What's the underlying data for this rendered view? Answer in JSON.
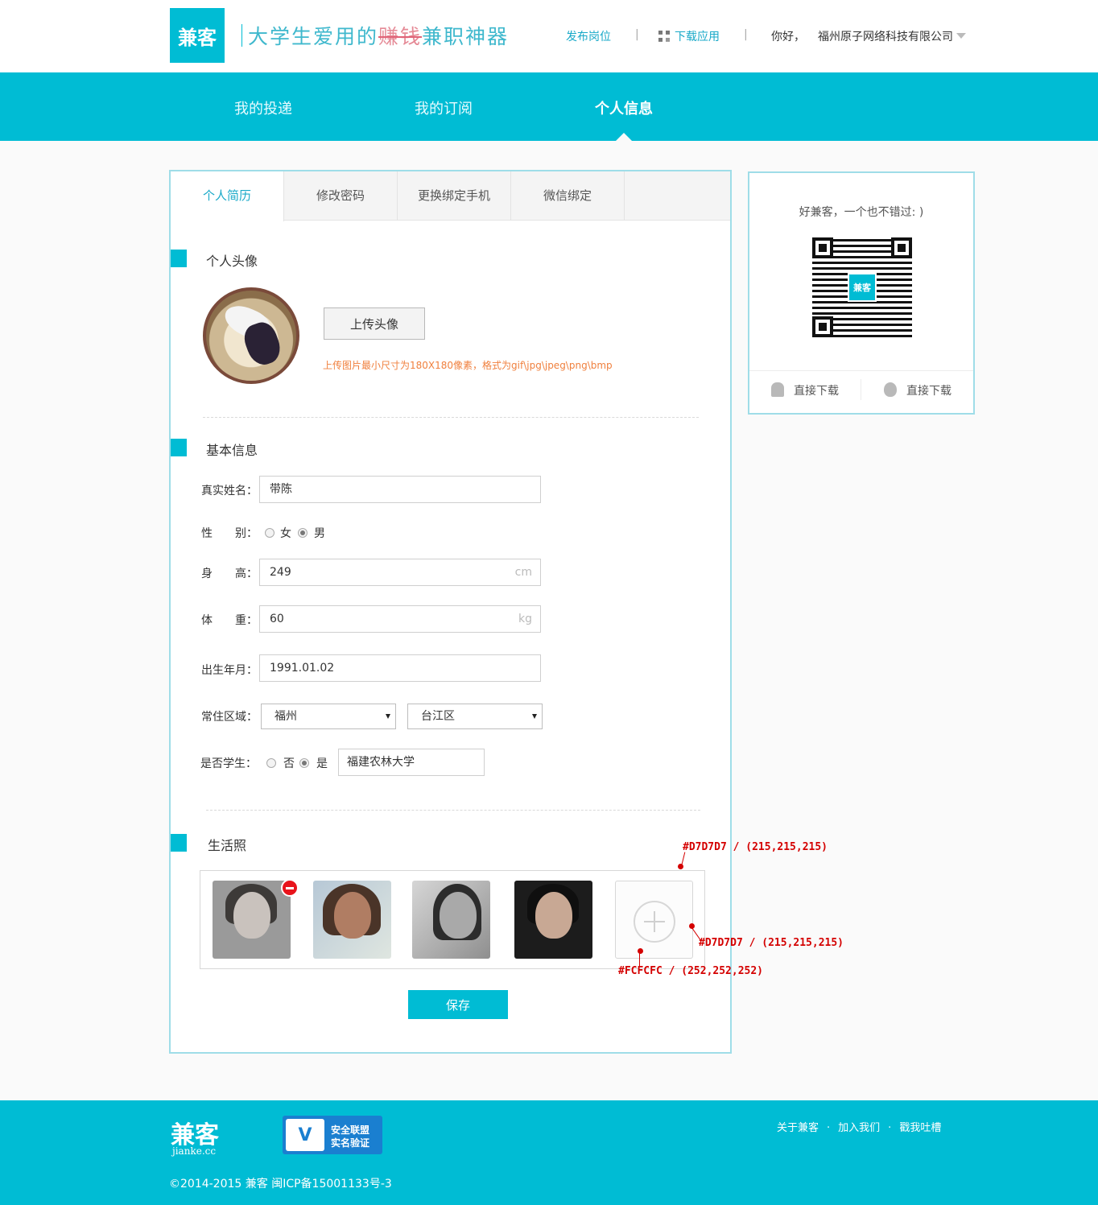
{
  "header": {
    "logo": "兼客",
    "slogan_prefix": "大学生爱用的",
    "slogan_strike": "赚钱",
    "slogan_suffix": "兼职神器",
    "post_job": "发布岗位",
    "sep1": "|",
    "download_app": "下载应用",
    "sep2": "|",
    "greeting": "你好，",
    "company": "福州原子网络科技有限公司"
  },
  "nav": {
    "items": [
      "我的投递",
      "我的订阅",
      "个人信息"
    ],
    "active_index": 2
  },
  "tabs": {
    "items": [
      "个人简历",
      "修改密码",
      "更换绑定手机",
      "微信绑定"
    ],
    "active_index": 0
  },
  "avatar_section": {
    "title": "个人头像",
    "upload_button": "上传头像",
    "upload_tip": "上传图片最小尺寸为180X180像素，格式为gif\\jpg\\jpeg\\png\\bmp"
  },
  "basic_info": {
    "title": "基本信息",
    "name_label": "真实姓名：",
    "name_value": "带陈",
    "gender_label": "性　　别：",
    "gender_female": "女",
    "gender_male": "男",
    "gender_selected": "男",
    "height_label": "身　　高：",
    "height_value": "249",
    "height_unit": "cm",
    "weight_label": "体　　重：",
    "weight_value": "60",
    "weight_unit": "kg",
    "birth_label": "出生年月：",
    "birth_value": "1991.01.02",
    "region_label": "常住区域：",
    "city_value": "福州",
    "district_value": "台江区",
    "student_label": "是否学生：",
    "student_no": "否",
    "student_yes": "是",
    "student_selected": "是",
    "school_value": "福建农林大学"
  },
  "life_photos": {
    "title": "生活照",
    "save_button": "保存"
  },
  "annotations": {
    "border_color": "#D7D7D7 / (215,215,215)",
    "circle_color": "#D7D7D7 / (215,215,215)",
    "bg_color": "#FCFCFC / (252,252,252)"
  },
  "side": {
    "slogan": "好兼客，一个也不错过: )",
    "qr_logo": "兼客",
    "android_download": "直接下载",
    "ios_download": "直接下载"
  },
  "footer": {
    "logo": "兼客",
    "domain": "jianke.cc",
    "badge_line1": "安全联盟",
    "badge_line2": "实名验证",
    "badge_mark": "V",
    "links": [
      "关于兼客",
      "加入我们",
      "戳我吐槽"
    ],
    "link_sep": "·",
    "copyright": "©2014-2015 兼客 闽ICP备15001133号-3"
  },
  "colors": {
    "accent": "#00bcd4",
    "border_light": "#9fdde8",
    "tip": "#f0803e",
    "annotation": "#d40000"
  }
}
